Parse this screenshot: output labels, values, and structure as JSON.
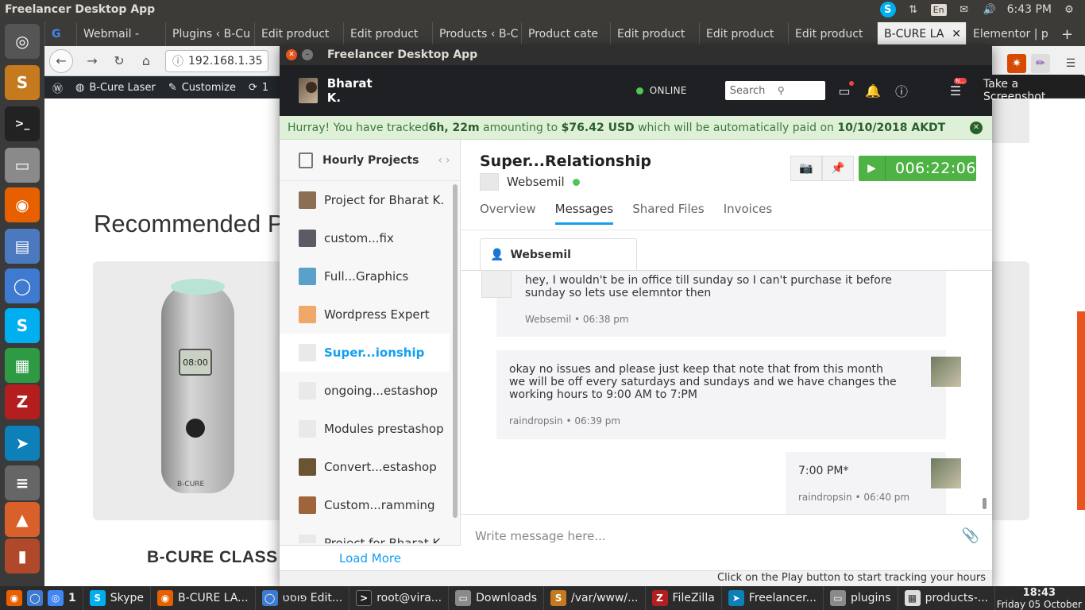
{
  "topbar": {
    "title": "Freelancer Desktop App",
    "lang": "En",
    "clock": "6:43 PM"
  },
  "browser": {
    "tabs": [
      {
        "label": "G",
        "icon": "google-icon"
      },
      {
        "label": "Webmail -",
        "icon": "cpanel-icon"
      },
      {
        "label": "Plugins ‹ B-Cu",
        "icon": ""
      },
      {
        "label": "Edit product",
        "icon": ""
      },
      {
        "label": "Edit product",
        "icon": ""
      },
      {
        "label": "Products ‹ B-C",
        "icon": ""
      },
      {
        "label": "Product cate",
        "icon": ""
      },
      {
        "label": "Edit product",
        "icon": ""
      },
      {
        "label": "Edit product",
        "icon": ""
      },
      {
        "label": "Edit product",
        "icon": ""
      },
      {
        "label": "B-CURE LA",
        "icon": ""
      },
      {
        "label": "Elementor | p",
        "icon": ""
      }
    ],
    "new_tab": "+",
    "url": "192.168.1.35",
    "wp_bar": {
      "site": "B-Cure Laser",
      "customize": "Customize",
      "updates": "1"
    },
    "page": {
      "recommended": "Recommended P",
      "product_name": "B-CURE CLASS",
      "device_screen": "08:00",
      "device_brand": "B-CURE"
    }
  },
  "freelancer": {
    "window_title": "Freelancer Desktop App",
    "user_name": "Bharat K.",
    "status": "ONLINE",
    "search_placeholder": "Search",
    "notification_badge": "N...",
    "banner": {
      "p1": "Hurray! You have tracked ",
      "hours": "6h, 22m",
      "p2": " amounting to ",
      "amount": "$76.42 USD",
      "p3": " which will be automatically paid on ",
      "date": "10/10/2018 AKDT"
    },
    "sidebar": {
      "title": "Hourly Projects",
      "projects": [
        {
          "label": "Project for Bharat K.",
          "color": "#8a6f55"
        },
        {
          "label": "custom...fix",
          "color": "#5b5b66"
        },
        {
          "label": "Full...Graphics",
          "color": "#5aa0c8"
        },
        {
          "label": "Wordpress Expert",
          "color": "#f0a868"
        },
        {
          "label": "Super...ionship",
          "color": "#e9e9e9"
        },
        {
          "label": "ongoing...estashop",
          "color": "#e9e9e9"
        },
        {
          "label": "Modules prestashop",
          "color": "#e9e9e9"
        },
        {
          "label": "Convert...estashop",
          "color": "#6b5434"
        },
        {
          "label": "Custom...ramming",
          "color": "#a0643c"
        },
        {
          "label": "Project for Bharat K.",
          "color": "#e9e9e9"
        }
      ],
      "load_more": "Load More"
    },
    "main": {
      "project_title": "Super...Relationship",
      "client": "Websemil",
      "timer": "006:22:06",
      "tabs": [
        "Overview",
        "Messages",
        "Shared Files",
        "Invoices"
      ],
      "thread_tab": "Websemil",
      "messages": [
        {
          "text": "hey, I wouldn't be in office till sunday so I can't purchase it before sunday so lets use elemntor then",
          "sender": "Websemil",
          "time": "06:38 pm"
        },
        {
          "text": "okay no issues and please just keep that note that from this month we will be off every saturdays and sundays and we have changes the working hours to 9:00 AM to 7:PM",
          "sender": "raindropsin",
          "time": "06:39 pm"
        },
        {
          "text": "7:00 PM*",
          "sender": "raindropsin",
          "time": "06:40 pm"
        }
      ],
      "compose_placeholder": "Write message here..."
    },
    "footer": "Click on the Play button to start tracking your hours"
  },
  "tooltip": "Take a Screenshot",
  "taskbar": {
    "items": [
      {
        "label": "1",
        "icon": "firefox"
      },
      {
        "label": "Skype",
        "icon": "skype"
      },
      {
        "label": "B-CURE LA...",
        "icon": "firefox"
      },
      {
        "label": "פוסט Edit...",
        "icon": "chromium"
      },
      {
        "label": "root@vira...",
        "icon": "terminal"
      },
      {
        "label": "Downloads",
        "icon": "folder"
      },
      {
        "label": "/var/www/...",
        "icon": "sublime"
      },
      {
        "label": "FileZilla",
        "icon": "filezilla"
      },
      {
        "label": "Freelancer...",
        "icon": "freelancer"
      },
      {
        "label": "plugins",
        "icon": "folder"
      },
      {
        "label": "products-...",
        "icon": "spreadsheet"
      }
    ],
    "time": "18:43",
    "date": "Friday 05 October"
  },
  "colors": {
    "accent": "#139ff0",
    "play": "#4fb244",
    "banner_bg": "#dff0d8",
    "header_bg": "#1f2024"
  }
}
